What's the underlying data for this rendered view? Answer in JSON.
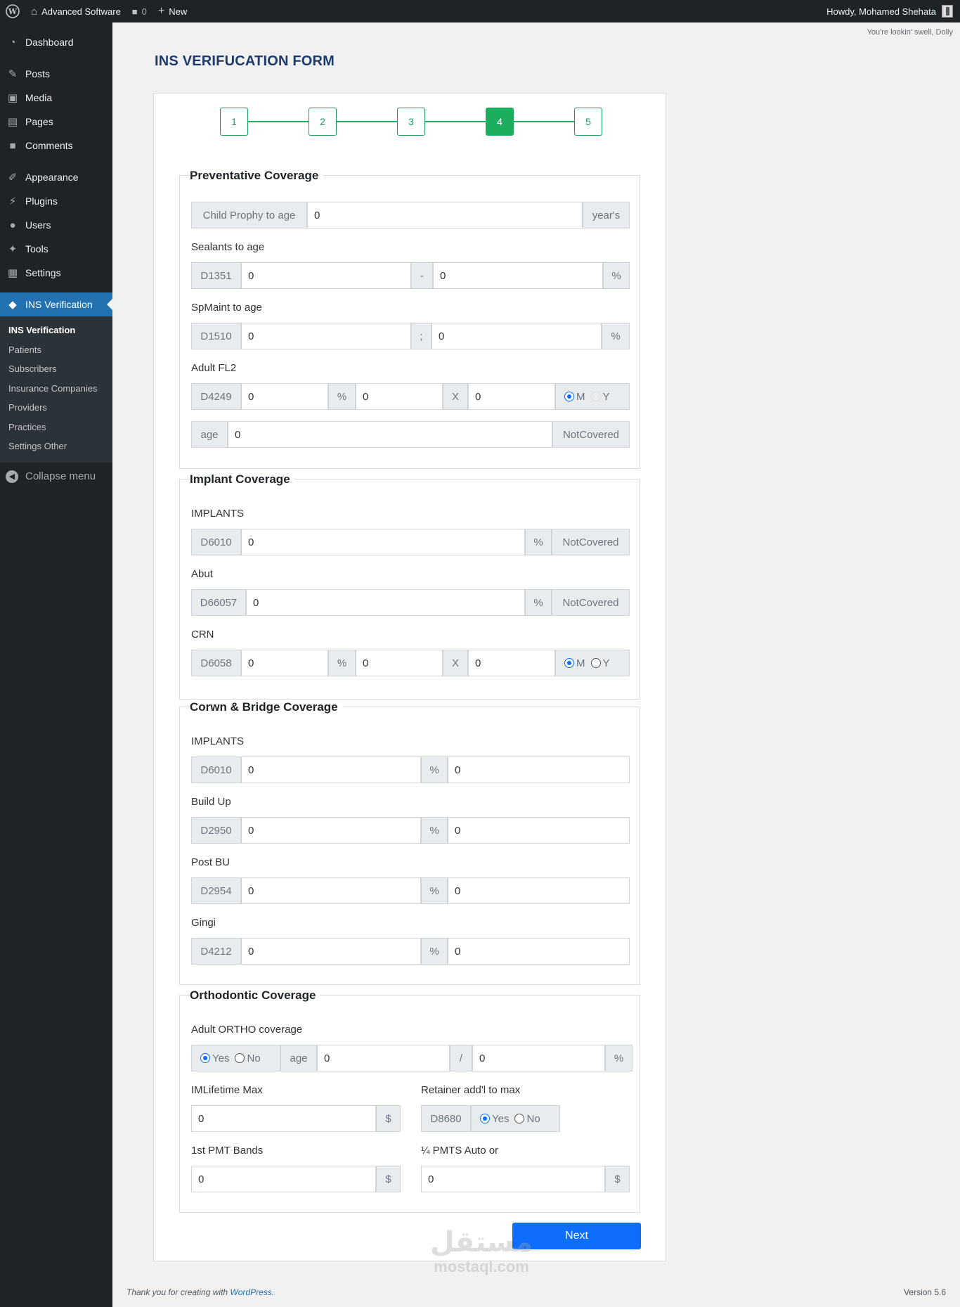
{
  "adminbar": {
    "site_name": "Advanced Software",
    "comments_count": "0",
    "new_label": "New",
    "howdy": "Howdy, Mohamed Shehata"
  },
  "sidebar": {
    "items": [
      {
        "label": "Dashboard",
        "icon": "dashboard-icon"
      },
      {
        "label": "Posts",
        "icon": "pin-icon"
      },
      {
        "label": "Media",
        "icon": "media-icon"
      },
      {
        "label": "Pages",
        "icon": "pages-icon"
      },
      {
        "label": "Comments",
        "icon": "comments-icon"
      },
      {
        "label": "Appearance",
        "icon": "brush-icon"
      },
      {
        "label": "Plugins",
        "icon": "plugin-icon"
      },
      {
        "label": "Users",
        "icon": "user-icon"
      },
      {
        "label": "Tools",
        "icon": "wrench-icon"
      },
      {
        "label": "Settings",
        "icon": "settings-icon"
      },
      {
        "label": "INS Verification",
        "icon": "tag-icon"
      }
    ],
    "submenu": [
      "INS Verification",
      "Patients",
      "Subscribers",
      "Insurance Companies",
      "Providers",
      "Practices",
      "Settings Other"
    ],
    "collapse": "Collapse menu"
  },
  "dolly": "You're lookin' swell, Dolly",
  "page_title": "INS VERIFUCATION FORM",
  "stepper": {
    "steps": [
      "1",
      "2",
      "3",
      "4",
      "5"
    ],
    "active": "4"
  },
  "preventative": {
    "legend": "Preventative Coverage",
    "child_prophy": {
      "label": "Child Prophy to age",
      "value": "0",
      "suffix": "year's"
    },
    "sealants": {
      "label": "Sealants to age",
      "code": "D1351",
      "v1": "0",
      "sep": "-",
      "v2": "0",
      "suffix": "%"
    },
    "spmaint": {
      "label": "SpMaint to age",
      "code": "D1510",
      "v1": "0",
      "sep": ";",
      "v2": "0",
      "suffix": "%"
    },
    "adult_fl2": {
      "label": "Adult FL2",
      "code": "D4249",
      "v1": "0",
      "pct": "%",
      "v2": "0",
      "x": "X",
      "v3": "0",
      "opt_m": "M",
      "opt_y": "Y"
    },
    "age": {
      "label": "age",
      "value": "0",
      "suffix": "NotCovered"
    }
  },
  "implant": {
    "legend": "Implant Coverage",
    "implants": {
      "label": "IMPLANTS",
      "code": "D6010",
      "value": "0",
      "pct": "%",
      "suffix": "NotCovered"
    },
    "abut": {
      "label": "Abut",
      "code": "D66057",
      "value": "0",
      "pct": "%",
      "suffix": "NotCovered"
    },
    "crn": {
      "label": "CRN",
      "code": "D6058",
      "v1": "0",
      "pct": "%",
      "v2": "0",
      "x": "X",
      "v3": "0",
      "opt_m": "M",
      "opt_y": "Y"
    }
  },
  "crown": {
    "legend": "Corwn & Bridge Coverage",
    "rows": [
      {
        "label": "IMPLANTS",
        "code": "D6010",
        "v1": "0",
        "pct": "%",
        "v2": "0"
      },
      {
        "label": "Build Up",
        "code": "D2950",
        "v1": "0",
        "pct": "%",
        "v2": "0"
      },
      {
        "label": "Post BU",
        "code": "D2954",
        "v1": "0",
        "pct": "%",
        "v2": "0"
      },
      {
        "label": "Gingi",
        "code": "D4212",
        "v1": "0",
        "pct": "%",
        "v2": "0"
      }
    ]
  },
  "ortho": {
    "legend": "Orthodontic Coverage",
    "adult": {
      "label": "Adult ORTHO coverage",
      "yes": "Yes",
      "no": "No",
      "age": "age",
      "v1": "0",
      "sep": "/",
      "v2": "0",
      "suffix": "%"
    },
    "lifetime": {
      "label": "IMLifetime Max",
      "value": "0",
      "suffix": "$"
    },
    "retainer": {
      "label": "Retainer add'l to max",
      "code": "D8680",
      "yes": "Yes",
      "no": "No"
    },
    "bands": {
      "label": "1st PMT Bands",
      "value": "0",
      "suffix": "$"
    },
    "pmts": {
      "label": "¼ PMTS Auto or",
      "value": "0",
      "suffix": "$"
    }
  },
  "next_label": "Next",
  "footer": {
    "thanks": "Thank you for creating with",
    "wp_link": "WordPress",
    "period": ".",
    "version": "Version 5.6"
  },
  "watermark": {
    "arabic": "مستقل",
    "latin": "mostaql.com"
  }
}
